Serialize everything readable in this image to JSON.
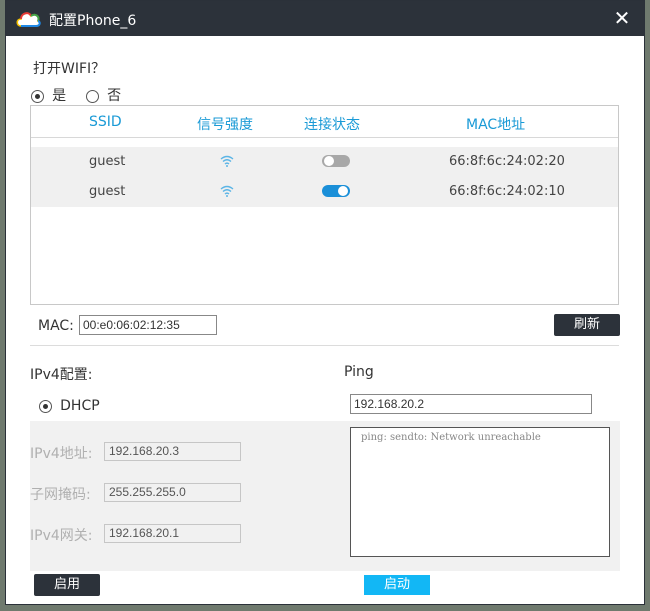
{
  "window": {
    "title": "配置Phone_6",
    "close_glyph": "✕"
  },
  "wifi": {
    "question": "打开WIFI？",
    "option_yes": "是",
    "option_no": "否",
    "selected": "yes",
    "columns": [
      "SSID",
      "信号强度",
      "连接状态",
      "MAC地址"
    ],
    "networks": [
      {
        "ssid": "guest",
        "signal_icon": "wifi-icon",
        "connected": false,
        "mac": "66:8f:6c:24:02:20"
      },
      {
        "ssid": "guest",
        "signal_icon": "wifi-icon",
        "connected": true,
        "mac": "66:8f:6c:24:02:10"
      }
    ],
    "mac_label": "MAC:",
    "mac_value": "00:e0:06:02:12:35",
    "refresh_label": "刷新"
  },
  "ipv4": {
    "heading": "IPv4配置:",
    "dhcp_label": "DHCP",
    "dhcp_selected": true,
    "address_label": "IPv4地址:",
    "address_value": "192.168.20.3",
    "mask_label": "子网掩码:",
    "mask_value": "255.255.255.0",
    "gateway_label": "IPv4网关:",
    "gateway_value": "192.168.20.1",
    "apply_label": "启用"
  },
  "ping": {
    "heading": "Ping",
    "target": "192.168.20.2",
    "output": "ping: sendto: Network unreachable",
    "start_label": "启动"
  },
  "colors": {
    "titlebar": "#2c323a",
    "accent_blue": "#1a9ad6",
    "button_blue": "#12b7f5",
    "toggle_on": "#1a8fd8",
    "toggle_off": "#a8a8a8"
  }
}
